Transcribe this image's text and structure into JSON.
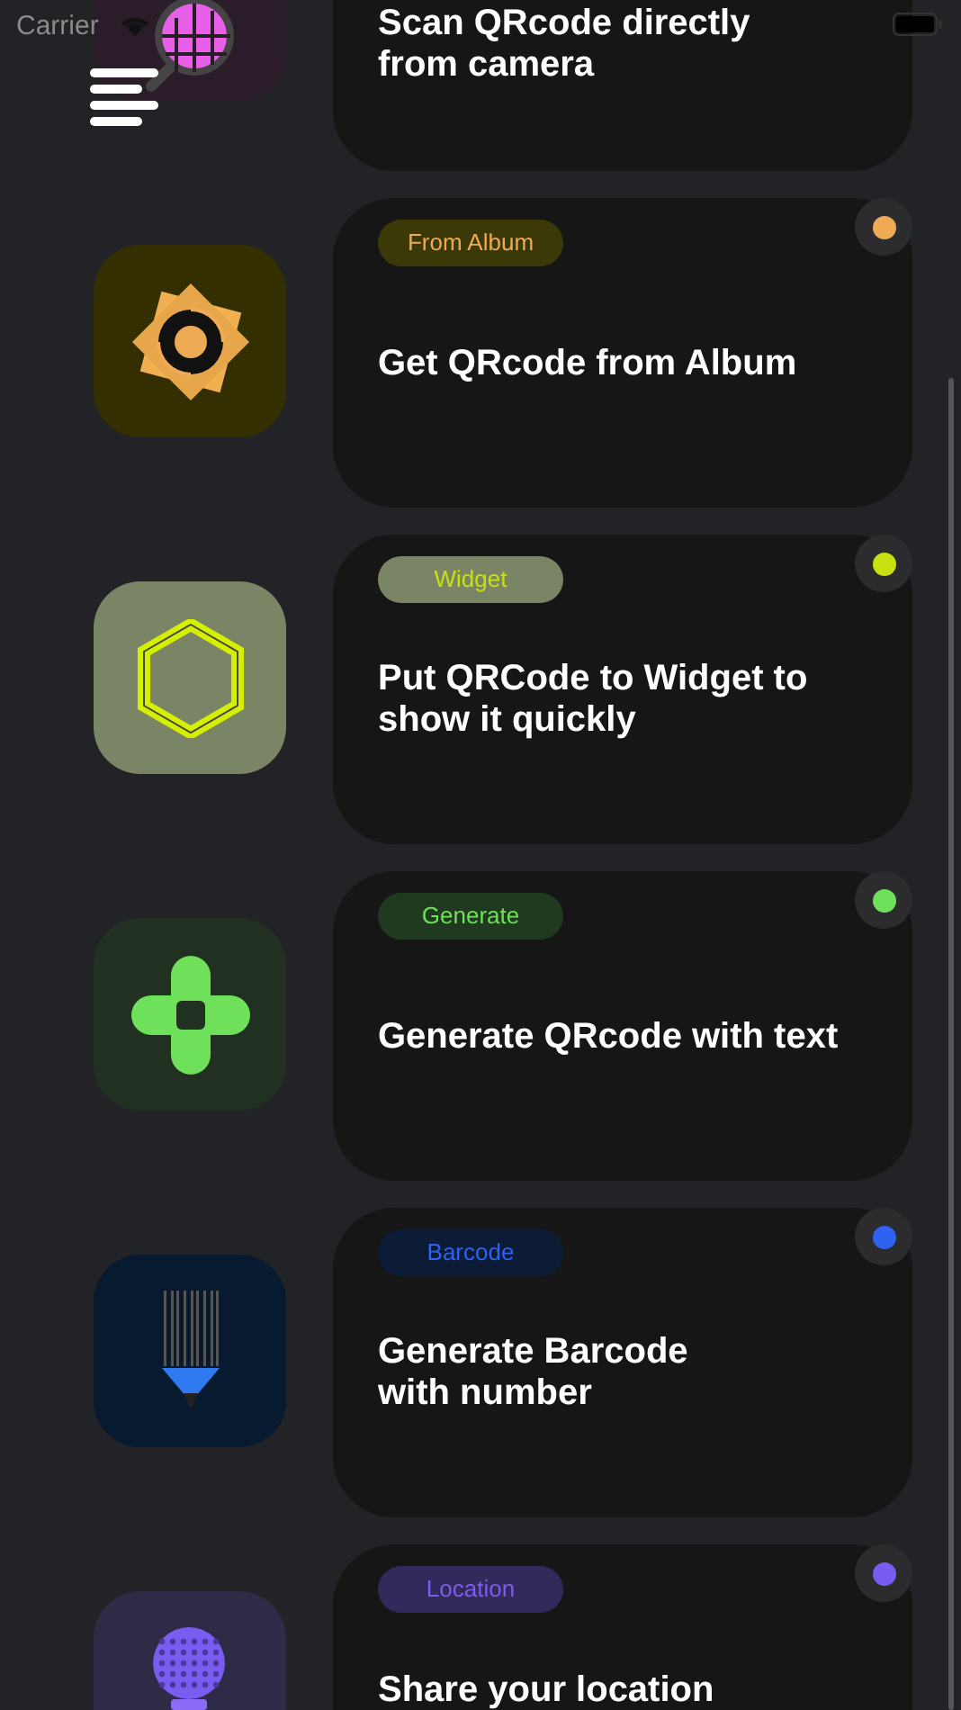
{
  "status_bar": {
    "carrier": "Carrier"
  },
  "features": [
    {
      "kind": "scan",
      "title": [
        "Scan QRcode directly",
        "from camera"
      ]
    },
    {
      "kind": "album",
      "badge": "From Album",
      "title": [
        "Get QRcode from Album"
      ],
      "color": "#eeaa55"
    },
    {
      "kind": "widget",
      "badge": "Widget",
      "title": [
        "Put QRCode to Widget to",
        "show it quickly"
      ],
      "color": "#c9e010"
    },
    {
      "kind": "generate",
      "badge": "Generate",
      "title": [
        "Generate QRcode with text"
      ],
      "color": "#6ee05a"
    },
    {
      "kind": "barcode",
      "badge": "Barcode",
      "title": [
        "Generate Barcode",
        "with number"
      ],
      "color": "#2f62f0"
    },
    {
      "kind": "location",
      "badge": "Location",
      "title": [
        "Share your location"
      ],
      "color": "#7b5cf0"
    }
  ]
}
